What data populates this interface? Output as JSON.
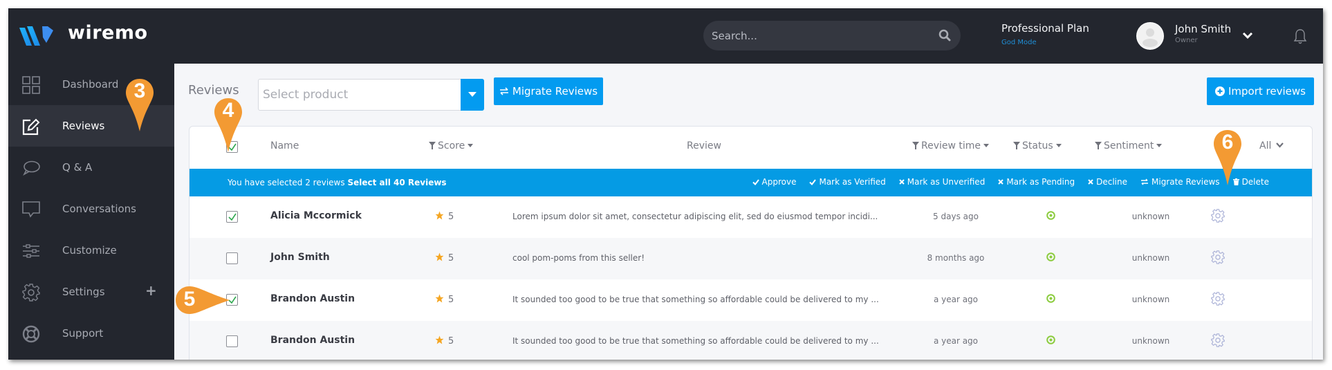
{
  "header": {
    "brand": "wiremo",
    "search_placeholder": "Search...",
    "plan_name": "Professional Plan",
    "plan_mode": "God Mode",
    "user_name": "John Smith",
    "user_role": "Owner"
  },
  "sidebar": {
    "items": [
      {
        "label": "Dashboard",
        "icon": "dashboard-grid-icon",
        "active": false
      },
      {
        "label": "Reviews",
        "icon": "edit-icon",
        "active": true
      },
      {
        "label": "Q & A",
        "icon": "chat-bubble-icon",
        "active": false
      },
      {
        "label": "Conversations",
        "icon": "conversation-icon",
        "active": false
      },
      {
        "label": "Customize",
        "icon": "sliders-icon",
        "active": false
      },
      {
        "label": "Settings",
        "icon": "gear-icon",
        "active": false,
        "expand": "+"
      },
      {
        "label": "Support",
        "icon": "lifebuoy-icon",
        "active": false
      }
    ]
  },
  "toolbar": {
    "title": "Reviews",
    "select_placeholder": "Select product",
    "migrate_label": "Migrate Reviews",
    "import_label": "Import reviews"
  },
  "table": {
    "columns": {
      "name": "Name",
      "score": "Score",
      "review": "Review",
      "review_time": "Review time",
      "status": "Status",
      "sentiment": "Sentiment",
      "all": "All"
    },
    "header_checked": true,
    "bulk": {
      "info": "You have selected 2 reviews",
      "select_all": "Select all 40 Reviews",
      "actions": [
        {
          "label": "Approve",
          "icon": "check-icon"
        },
        {
          "label": "Mark as Verified",
          "icon": "check-icon"
        },
        {
          "label": "Mark as Unverified",
          "icon": "x-icon"
        },
        {
          "label": "Mark as Pending",
          "icon": "x-icon"
        },
        {
          "label": "Decline",
          "icon": "x-icon"
        },
        {
          "label": "Migrate Reviews",
          "icon": "swap-icon"
        },
        {
          "label": "Delete",
          "icon": "trash-icon"
        }
      ]
    },
    "rows": [
      {
        "checked": true,
        "name": "Alicia Mccormick",
        "score": "5",
        "review": "Lorem ipsum dolor sit amet, consectetur adipiscing elit, sed do eiusmod tempor incidi...",
        "time": "5 days ago",
        "status": "active",
        "sentiment": "unknown"
      },
      {
        "checked": false,
        "name": "John Smith",
        "score": "5",
        "review": "cool pom-poms from this seller!",
        "time": "8 months ago",
        "status": "active",
        "sentiment": "unknown"
      },
      {
        "checked": true,
        "name": "Brandon Austin",
        "score": "5",
        "review": "It sounded too good to be true that something so affordable could be delivered to my ...",
        "time": "a year ago",
        "status": "active",
        "sentiment": "unknown"
      },
      {
        "checked": false,
        "name": "Brandon Austin",
        "score": "5",
        "review": "It sounded too good to be true that something so affordable could be delivered to my ...",
        "time": "a year ago",
        "status": "active",
        "sentiment": "unknown"
      }
    ]
  },
  "callouts": [
    "3",
    "4",
    "5",
    "6"
  ],
  "colors": {
    "accent": "#039bf0",
    "bulkbar": "#059be4",
    "sidebar": "#23262e",
    "callout": "#f39a33",
    "status_active": "#8ccc3f",
    "star": "#f5a623",
    "check": "#2fa84f"
  }
}
